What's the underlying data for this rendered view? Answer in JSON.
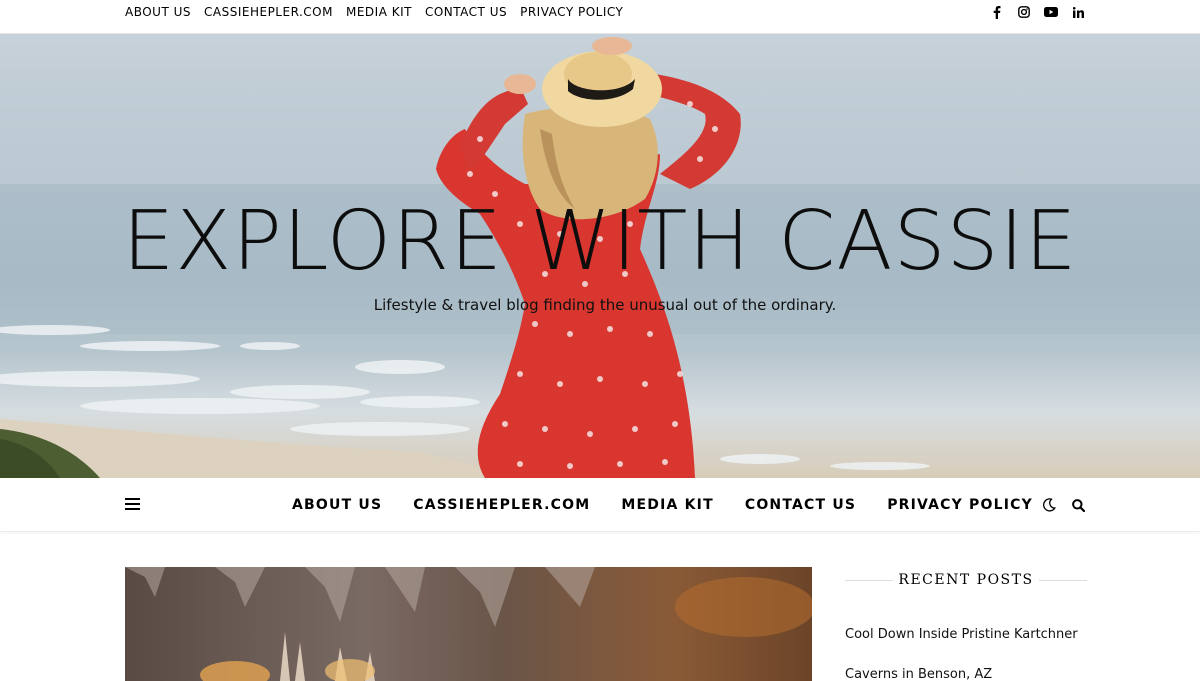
{
  "top_nav": {
    "links": [
      "ABOUT US",
      "CASSIEHEPLER.COM",
      "MEDIA KIT",
      "CONTACT US",
      "PRIVACY POLICY"
    ],
    "social_icons": [
      "facebook-icon",
      "instagram-icon",
      "youtube-icon",
      "linkedin-icon"
    ]
  },
  "hero": {
    "title": "EXPLORE WITH CASSIE",
    "tagline": "Lifestyle & travel blog finding the unusual out of the ordinary."
  },
  "main_nav": {
    "menu_icon": "hamburger-icon",
    "links": [
      "ABOUT US",
      "CASSIEHEPLER.COM",
      "MEDIA KIT",
      "CONTACT US",
      "PRIVACY POLICY"
    ],
    "tools": [
      "moon-icon",
      "search-icon"
    ]
  },
  "sidebar": {
    "recent_posts_title": "RECENT POSTS",
    "recent_posts": [
      "Cool Down Inside Pristine Kartchner Caverns in Benson, AZ"
    ]
  },
  "colors": {
    "text": "#000000",
    "dress_red": "#d8362f",
    "sea": "#a9bcc7"
  }
}
